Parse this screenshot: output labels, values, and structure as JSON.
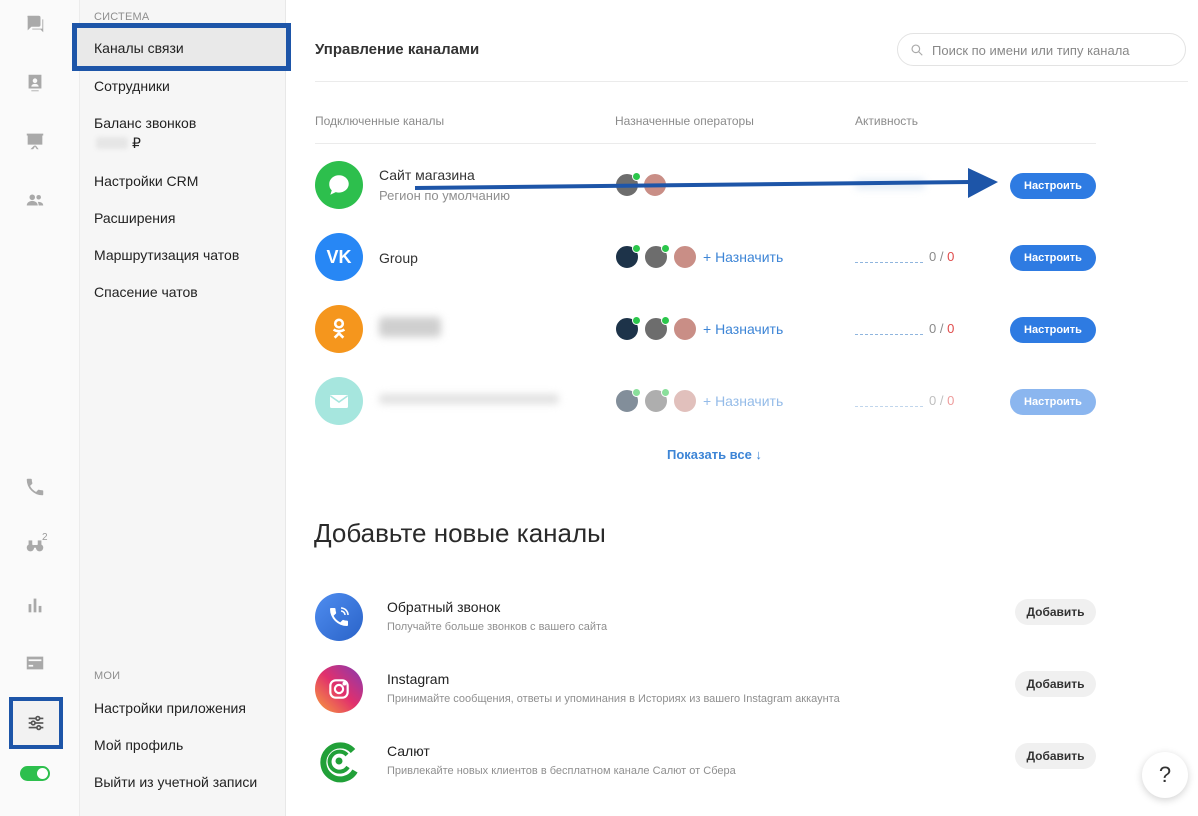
{
  "sidebar": {
    "section_system": "СИСТЕМА",
    "active_item": "Каналы связи",
    "items": [
      {
        "label": "Сотрудники"
      },
      {
        "label": "Баланс звонков"
      },
      {
        "label": "Настройки CRM"
      },
      {
        "label": "Расширения"
      },
      {
        "label": "Маршрутизация чатов"
      },
      {
        "label": "Спасение чатов"
      }
    ],
    "balance_currency": "₽",
    "section_mine": "МОИ",
    "bottom_items": [
      {
        "label": "Настройки приложения"
      },
      {
        "label": "Мой профиль"
      },
      {
        "label": "Выйти из учетной записи"
      }
    ]
  },
  "rail": {
    "badge_count": "2",
    "icons": [
      "chat-icon",
      "contacts-icon",
      "presentation-icon",
      "team-icon",
      "phone-icon",
      "binoculars-icon",
      "stats-icon",
      "card-icon",
      "settings-sliders-icon"
    ],
    "toggle_on": true,
    "accent": "#1d55a8"
  },
  "main": {
    "title": "Управление каналами",
    "search_placeholder": "Поиск по имени или типу канала",
    "columns": {
      "channels": "Подключенные каналы",
      "operators": "Назначенные операторы",
      "activity": "Активность"
    },
    "channels": [
      {
        "name": "Сайт магазина",
        "subtitle": "Регион по умолчанию",
        "button": "Настроить",
        "color": "#2dbf4d"
      },
      {
        "name": "Group",
        "assign": "+ Назначить",
        "act_a": "0",
        "act_sep": " / ",
        "act_b": "0",
        "button": "Настроить",
        "color": "#2787f5"
      },
      {
        "name": "",
        "assign": "+ Назначить",
        "act_a": "0",
        "act_sep": " / ",
        "act_b": "0",
        "button": "Настроить",
        "color": "#f5961d"
      },
      {
        "name": "",
        "assign": "+ Назначить",
        "act_a": "0",
        "act_sep": " / ",
        "act_b": "0",
        "button": "Настроить",
        "color": "#5fd2c4"
      }
    ],
    "show_all": "Показать все ↓",
    "add_title": "Добавьте новые каналы",
    "add_channels": [
      {
        "name": "Обратный звонок",
        "desc": "Получайте больше звонков с вашего сайта",
        "button": "Добавить"
      },
      {
        "name": "Instagram",
        "desc": "Принимайте сообщения, ответы и упоминания в Историях из вашего Instagram аккаунта",
        "button": "Добавить"
      },
      {
        "name": "Салют",
        "desc": "Привлекайте новых клиентов в бесплатном канале Салют от Сбера",
        "button": "Добавить"
      }
    ],
    "help": "?"
  }
}
